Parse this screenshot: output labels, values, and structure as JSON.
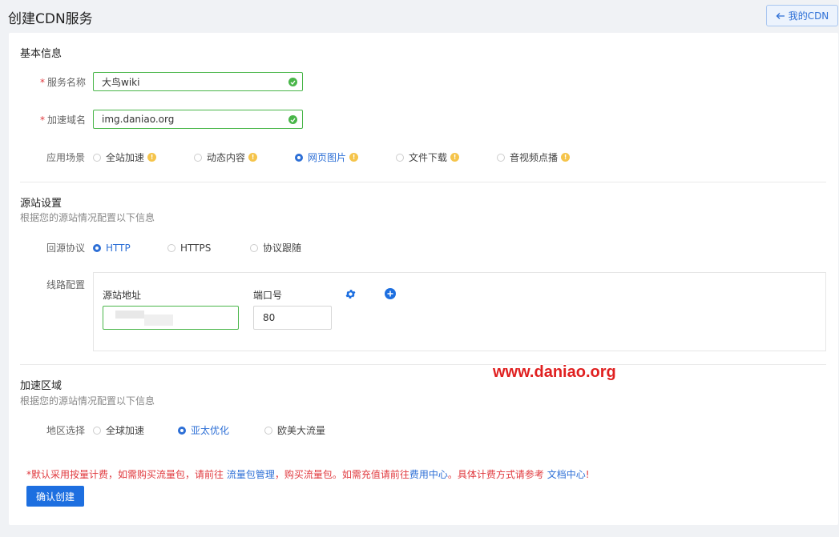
{
  "header": {
    "title": "创建CDN服务",
    "back_button_label": "我的CDN"
  },
  "basic": {
    "section_title": "基本信息",
    "service_name": {
      "label": "服务名称",
      "value": "大鸟wiki"
    },
    "domain": {
      "label": "加速域名",
      "value": "img.daniao.org"
    },
    "scenario": {
      "label": "应用场景",
      "options": [
        "全站加速",
        "动态内容",
        "网页图片",
        "文件下载",
        "音视频点播"
      ],
      "selected": "网页图片"
    }
  },
  "origin": {
    "section_title": "源站设置",
    "description": "根据您的源站情况配置以下信息",
    "protocol": {
      "label": "回源协议",
      "options": [
        "HTTP",
        "HTTPS",
        "协议跟随"
      ],
      "selected": "HTTP"
    },
    "route": {
      "label": "线路配置",
      "address_label": "源站地址",
      "port_label": "端口号",
      "port_value": "80"
    }
  },
  "region": {
    "section_title": "加速区域",
    "description": "根据您的源站情况配置以下信息",
    "selection": {
      "label": "地区选择",
      "options": [
        "全球加速",
        "亚太优化",
        "欧美大流量"
      ],
      "selected": "亚太优化"
    }
  },
  "watermark": "www.daniao.org",
  "notice": {
    "part1": "*默认采用按量计费，如需购买流量包，请前往 ",
    "link1": "流量包管理",
    "part2": "，购买流量包。如需充值请前往",
    "link2": "费用中心",
    "part3": "。具体计费方式请参考 ",
    "link3": "文档中心",
    "part4": "!"
  },
  "submit_label": "确认创建",
  "colors": {
    "primary": "#1d6fe0",
    "success": "#49b649",
    "required": "#e0393e",
    "info": "#f5c44b"
  }
}
